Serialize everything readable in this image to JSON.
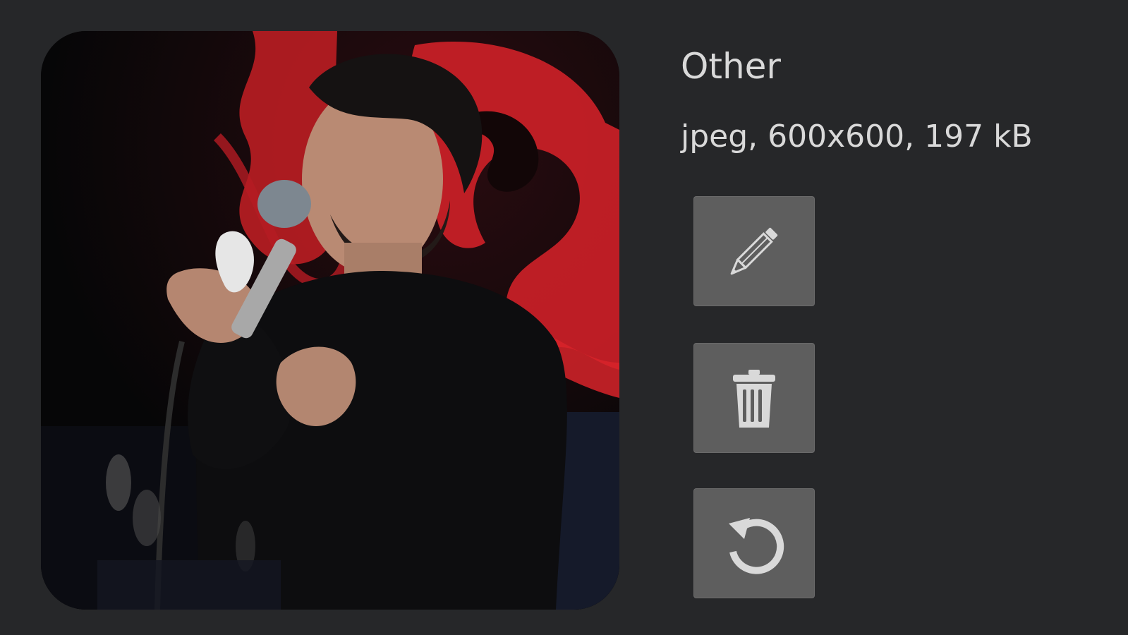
{
  "cover": {
    "alt_icon": "album-cover-image",
    "subject": "man singing into microphone"
  },
  "info": {
    "title": "Other",
    "meta": "jpeg, 600x600, 197 kB"
  },
  "actions": {
    "edit_icon": "pencil-icon",
    "delete_icon": "trash-icon",
    "reset_icon": "undo-icon"
  },
  "colors": {
    "background": "#262729",
    "button": "#5e5e5e",
    "icon": "#d9d9d9",
    "accent_red": "#d8232a"
  }
}
